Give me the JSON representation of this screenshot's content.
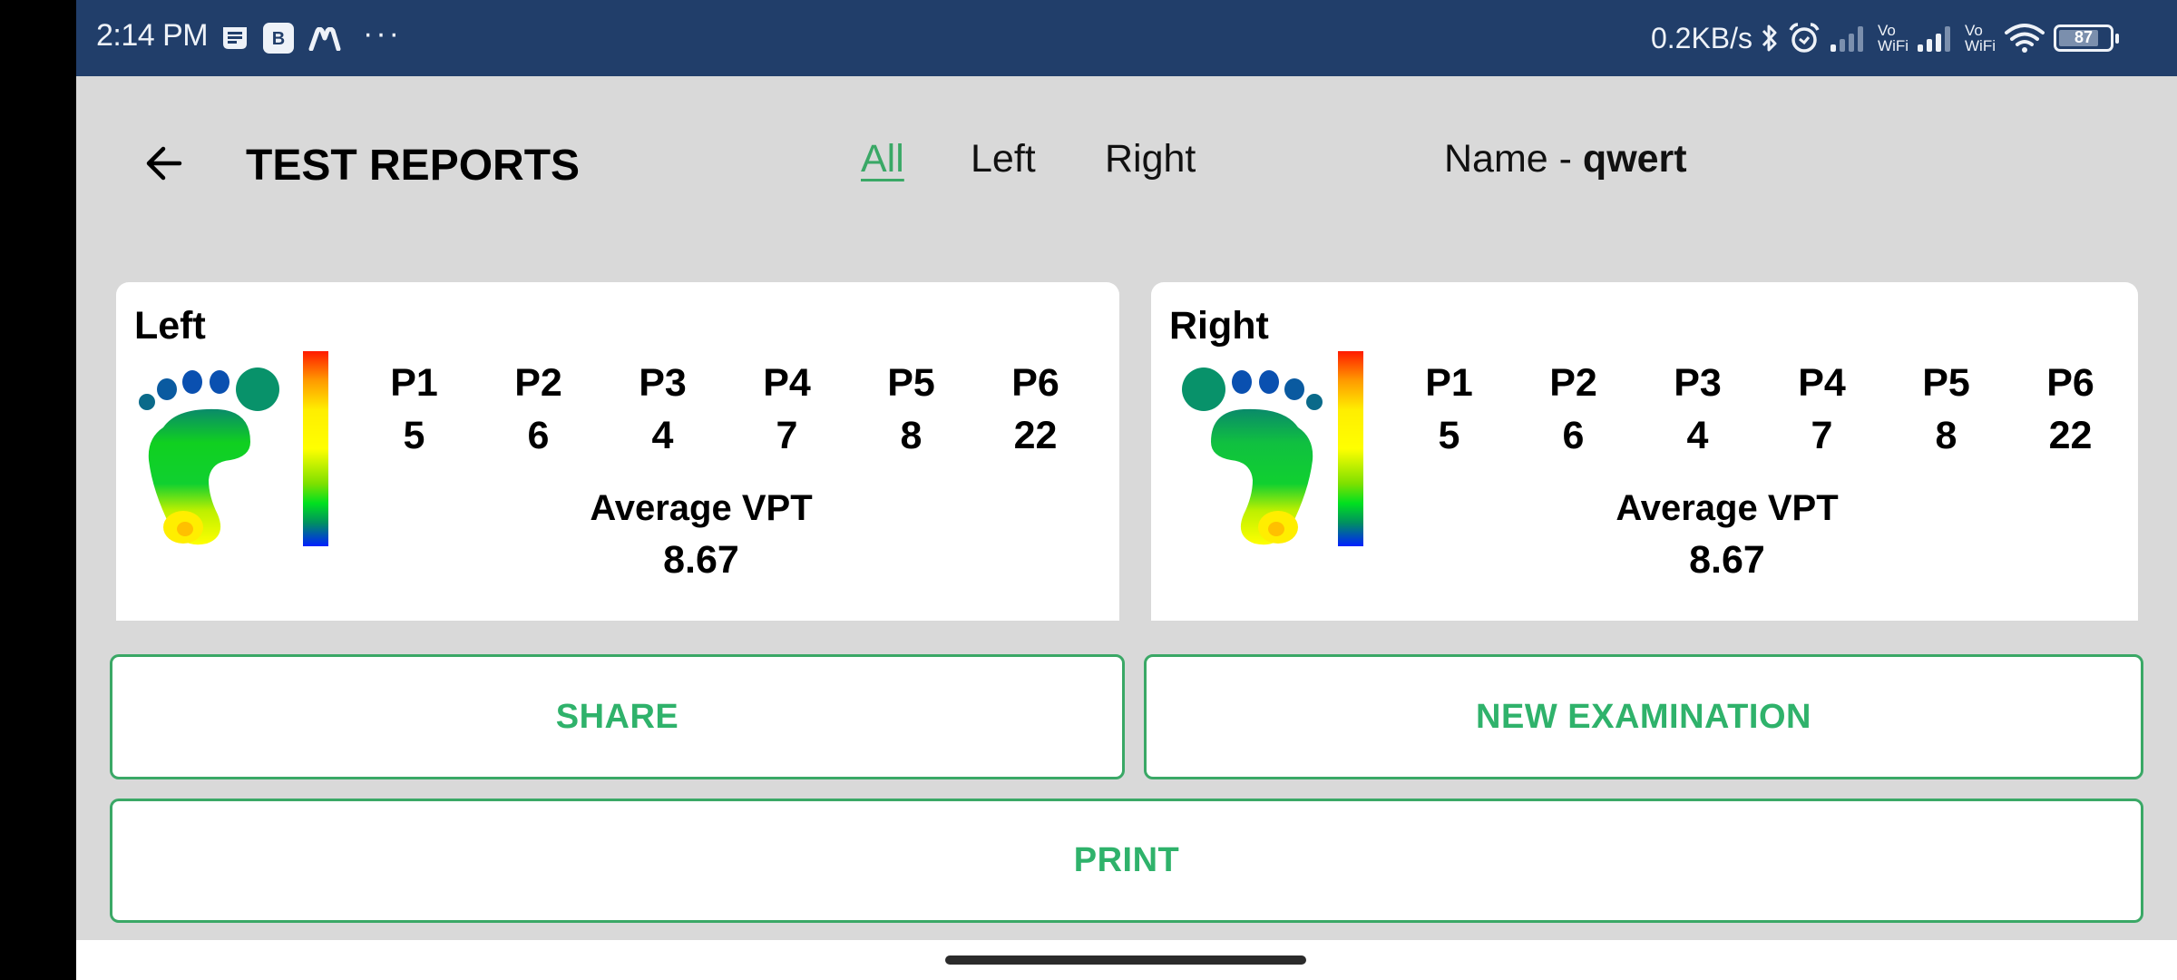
{
  "status_bar": {
    "time": "2:14 PM",
    "left_icons": [
      "notes-icon",
      "b-app-icon",
      "m-app-icon",
      "more-dots-icon"
    ],
    "b_app_letter": "B",
    "more_dots": "···",
    "net_speed": "0.2KB/s",
    "vowifi_top": "Vo",
    "vowifi_bottom": "WiFi",
    "battery_level": "87",
    "right_icons": [
      "bluetooth-icon",
      "alarm-icon",
      "signal-1-icon",
      "vowifi-1-icon",
      "signal-2-icon",
      "vowifi-2-icon",
      "wifi-icon",
      "battery-icon"
    ]
  },
  "header": {
    "back_icon": "arrow-left-icon",
    "title": "TEST REPORTS",
    "tabs": [
      {
        "label": "All",
        "active": true
      },
      {
        "label": "Left",
        "active": false
      },
      {
        "label": "Right",
        "active": false
      }
    ],
    "name_label": "Name - ",
    "name_value": "qwert"
  },
  "reports": [
    {
      "side": "Left",
      "points": [
        {
          "label": "P1",
          "value": "5"
        },
        {
          "label": "P2",
          "value": "6"
        },
        {
          "label": "P3",
          "value": "4"
        },
        {
          "label": "P4",
          "value": "7"
        },
        {
          "label": "P5",
          "value": "8"
        },
        {
          "label": "P6",
          "value": "22"
        }
      ],
      "average_label": "Average VPT",
      "average_value": "8.67"
    },
    {
      "side": "Right",
      "points": [
        {
          "label": "P1",
          "value": "5"
        },
        {
          "label": "P2",
          "value": "6"
        },
        {
          "label": "P3",
          "value": "4"
        },
        {
          "label": "P4",
          "value": "7"
        },
        {
          "label": "P5",
          "value": "8"
        },
        {
          "label": "P6",
          "value": "22"
        }
      ],
      "average_label": "Average VPT",
      "average_value": "8.67"
    }
  ],
  "actions": {
    "share": "SHARE",
    "new_examination": "NEW EXAMINATION",
    "print": "PRINT"
  },
  "colors": {
    "status_bar": "#213e6a",
    "background": "#d9d9d9",
    "accent_green": "#3aa866",
    "card": "#ffffff"
  }
}
